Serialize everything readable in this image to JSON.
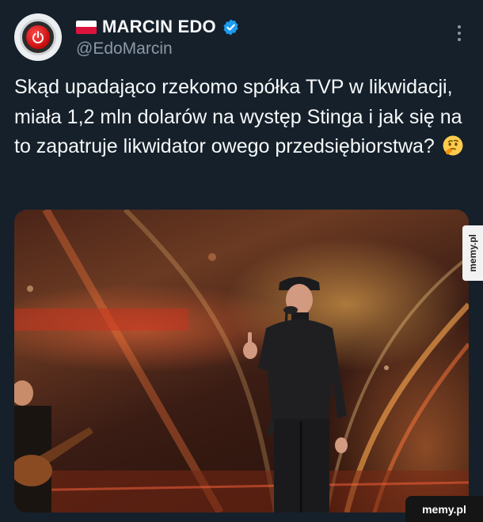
{
  "author": {
    "name": "MARCIN EDO",
    "handle": "@EdoMarcin",
    "flag_icon": "poland-flag-icon",
    "verified_icon": "verified-badge-icon",
    "verified_color": "#1d9bf0",
    "avatar_icon": "power-button-icon"
  },
  "tweet": {
    "text": "Skąd upadająco rzekomo spółka TVP w likwidacji, miała 1,2 mln dolarów na występ Stinga i jak się na to zapatruje likwidator owego przedsiębiorstwa?",
    "emoji_icon": "thinking-face-emoji"
  },
  "menu": {
    "icon": "more-options-icon"
  },
  "media": {
    "kind": "photo",
    "subject": "performer-on-stage"
  },
  "watermarks": {
    "side": "memy.pl",
    "corner": "memy.pl"
  },
  "colors": {
    "background": "#15202b",
    "text": "#f7f9f9",
    "secondary": "#8b98a5",
    "brand_red": "#dc143c"
  }
}
